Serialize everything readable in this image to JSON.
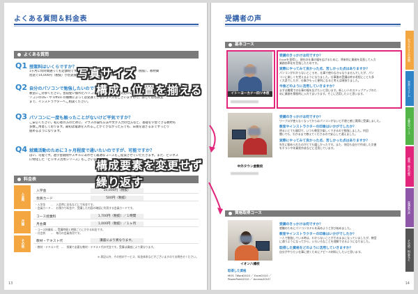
{
  "left": {
    "title": "よくある質問＆料金表",
    "faq_bar": "よくある質問",
    "questions": [
      {
        "label": "Q1",
        "text": "授業料はいくらですか？",
        "body": [
          "1ヶ月に何時間通っても定額制です。受講料はテキスト代込みで月額10,000円（税抜）、教材費",
          "別途で14,000円（税抜）が別途施設利用料としてかかります。"
        ]
      },
      {
        "label": "Q2",
        "text": "自分のパソコンで勉強したいのですが…",
        "body": [
          "教室にご持参ください。普段使い慣れたパソコンで受講できます。対応OSはWindowsとMac。ノートパ",
          "ソコンのOS・や Office の種類によっては受講できないコースもございますので、詳しくは各教室",
          "まで、インストラクターへご相談ください。"
        ]
      },
      {
        "label": "Q3",
        "text": "パソコンに一度も触ったことがないけど平気ですか？",
        "body": [
          "ご安心ください。初心者の方のために、マウスの操作方法や文字入力の仕方など、基礎を学習できる教材も",
          "多数ご用意しております。最初は電源を入れることができなかった方でも、日後を過ぎるまでずっとり",
          "組めるようになります。"
        ]
      },
      {
        "label": "Q4",
        "text": "就職活動のために３ヶ月程度で通いたいのですが、可能ですか？",
        "body": [
          "はい、可能です。週学習期間やスキルにあわせて最適なコースをご提案させていただきます。また、ビジネス",
          "に特化した「ビジネス活用シリーズ」もございます。ぜひご利用ください。"
        ]
      }
    ],
    "fee_bar": "料金表",
    "fee_categories": [
      "入会時",
      "月額",
      "その他"
    ],
    "fee_rows": [
      {
        "k": "入学金",
        "v": "10,000円（税抜）"
      },
      {
        "k": "会員カード",
        "v": "500円（税抜）"
      },
      {
        "k": "コース授業料",
        "v": "1,700円（税抜）／１時間"
      },
      {
        "k": "月会費",
        "v": "1,000円（税抜）／１ヶ月"
      },
      {
        "k": "教材・テキスト代",
        "v": "講座により異なります。"
      }
    ],
    "notes": [
      "・入学金　　…　入会時に支払などにて料金です。",
      "・会員カード…　お預かり料金や、受講した内容の確認に利用する会員カードです。",
      "・コース授業料 … 受講時間１時間ごとにかかる料金です。",
      "・月会費　　…　毎月の会員費用です。",
      "・教材・テキスト代　…　授業で必要な教材・テキスト代の代金です。受講は講座により異なります。",
      "※ 表記以外、その他のサービス、料金体系などがございますのでお問合せください。"
    ],
    "page_num": "13"
  },
  "right": {
    "title": "受講者の声",
    "courses": [
      "基本コース",
      "資格取得コース"
    ],
    "captions": [
      "イトーヨーカドー四ツ木校",
      "中外タウン倉敷校",
      "イオン八幡校"
    ],
    "qualification_label": "取得した資格",
    "qualification_value": [
      "MOS（Word2010 ／ Excel2010 ／",
      "PowerPoint2010 ／ Access2010）"
    ],
    "answers": [
      {
        "q1": "受講のきっかけは何ですか？",
        "b1": [
          "Excelを習得し、現在の仕事の幅を広げるために、将来的に業務を見直して入力",
          "業務効率化を目指したためです。"
        ],
        "q2": "実際にやってみて良かった点、苦しかった点はありますか？",
        "b2": [
          "パソコンがわからないところを、仕事で使わなきゃなりませんでしたが、パソ",
          "コンに楽しくを覚えるようになりました。仕事後の受講は終る毛程にことも多",
          "く大変でしたが、仕事がもっと便利になると考えば頑張りました。"
        ],
        "q3": "今後どのように活用していきますか？",
        "b3": [
          "まずは職場での仕事の幅を広げたいと思います。新しい人のステップアップのた",
          "めに業務を積極的に入れてまいります。そこに活用したいと思います。"
        ]
      },
      {
        "q1": "受講のきっかけは何ですか？",
        "b1": [
          "ワープロが使えなくなってからはパソコンがないと不便と感じ実際に受講しました。"
        ],
        "q2": "教室やインストラクターの印象はいかがでしたか？",
        "b2": [
          "明るいとても親切で、いつも教室が楽しくできるので勉強しました。何回",
          "聞いても、わかるまで教えてくださるので安心して通えました。"
        ],
        "q3": "実際にやってみて良かった点、苦しかった点はありますか？",
        "b3": [
          "先生に勧められたのがとても嬉しかったです。また、何回も自分で作成した文書",
          "をチラシや年賀状作成などに活用しています。"
        ]
      },
      {
        "q1": "受講のきっかけは何ですか？",
        "b1": [
          "就職のためにパソコンスキルを高めようと学び始めました。"
        ],
        "q2": "教室やインストラクターの印象はいかがでしたか？",
        "b2": [
          "一人で勉強している時は、わからないことがそのままになっていましたが、教室",
          "に通うようになってから、いろいろなことを理解できるようになりました。"
        ],
        "q3": "取得した資格をどのように活用していきますか？",
        "b3": [
          "自分がやりたい仕事に就くためにアピール材料にしたいと思います。"
        ]
      }
    ],
    "side_tabs": [
      "わかりやすさの特徴",
      "学習システム",
      "充実のコース",
      "資格・検定対策",
      "受講者の声",
      "その他・料金など"
    ],
    "side_tab_colors": [
      "#f4a640",
      "#2f84c8",
      "#53b548",
      "#e2257a",
      "#8e57a8",
      "#555555"
    ],
    "page_num": "14"
  },
  "annotations": {
    "line1": "写真サイズ",
    "line2": "構成・位置を揃える",
    "line3": "構成要素を変更せず",
    "line4": "繰り返す"
  },
  "colors": {
    "accent": "#2f84c8",
    "highlight": "#e2257a",
    "fee_cat": "#f4a640"
  }
}
